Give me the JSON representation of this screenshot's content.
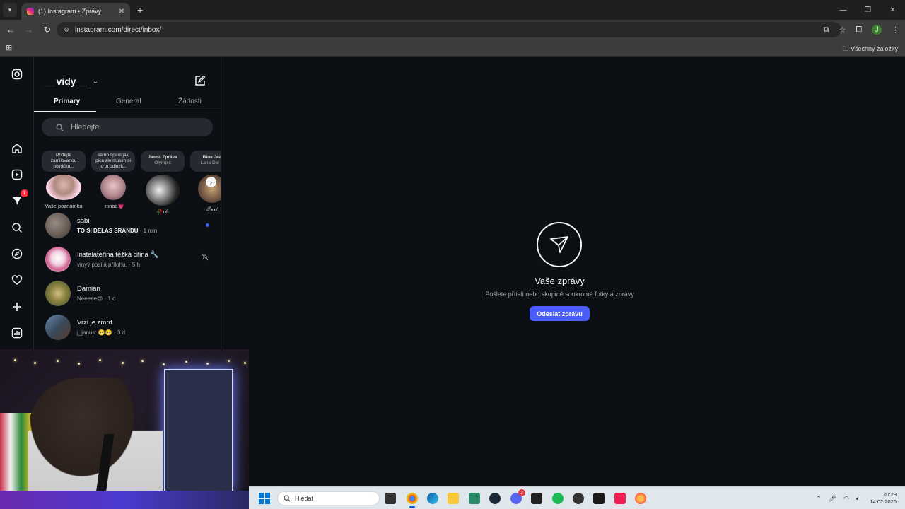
{
  "browser": {
    "tab_title": "(1) Instagram • Zprávy",
    "tab_close": "✕",
    "new_tab": "+",
    "url": "instagram.com/direct/inbox/",
    "bookmarks_label": "Všechny záložky",
    "profile_initial": "J",
    "window_controls": [
      "—",
      "❐",
      "✕"
    ]
  },
  "sidebar": {
    "notifications_badge": "1"
  },
  "inbox": {
    "username": "__vidy__",
    "tabs": [
      "Primary",
      "General",
      "Žádosti"
    ],
    "search_placeholder": "Hledejte",
    "notes": [
      {
        "bubble": "Přidejte zamilovanou písničku...",
        "name": "Vaše poznámka"
      },
      {
        "bubble": "kamo spam jak pica ale musim si to tu odlozit...",
        "name": "_ninaa💗"
      },
      {
        "bubble_title": "Jasná Zpráva",
        "bubble_sub": "Olympic",
        "name": "🥀ofi"
      },
      {
        "bubble_title": "Blue Jea",
        "bubble_sub": "Lana Del R",
        "name": "𝓣𝓮𝓻𝓲"
      }
    ],
    "threads": [
      {
        "name": "sabi",
        "preview": "TO SI DELAS SRANDU",
        "time": " · 1 min",
        "unread": true
      },
      {
        "name": "Instalatéřina těžká dřina 🔧",
        "preview": "vinyý posílá přílohu.",
        "time": " · 5 h",
        "muted": true
      },
      {
        "name": "Damian",
        "preview": "Neeeee😍",
        "time": " · 1 d"
      },
      {
        "name": "Vrzi je zmrd",
        "preview": "j_janus: 🥺🥺",
        "time": " · 3 d"
      }
    ]
  },
  "main": {
    "title": "Vaše zprávy",
    "subtitle": "Pošlete příteli nebo skupině soukromé fotky a zprávy",
    "button": "Odeslat zprávu"
  },
  "taskbar": {
    "search_placeholder": "Hledat",
    "time": "20:29",
    "date": "14.02.2026",
    "discord_badge": "2"
  },
  "colors": {
    "ig_bg": "#0c1014",
    "accent": "#4a5df9",
    "unread_dot": "#3b5bfb",
    "badge": "#ff3040"
  }
}
